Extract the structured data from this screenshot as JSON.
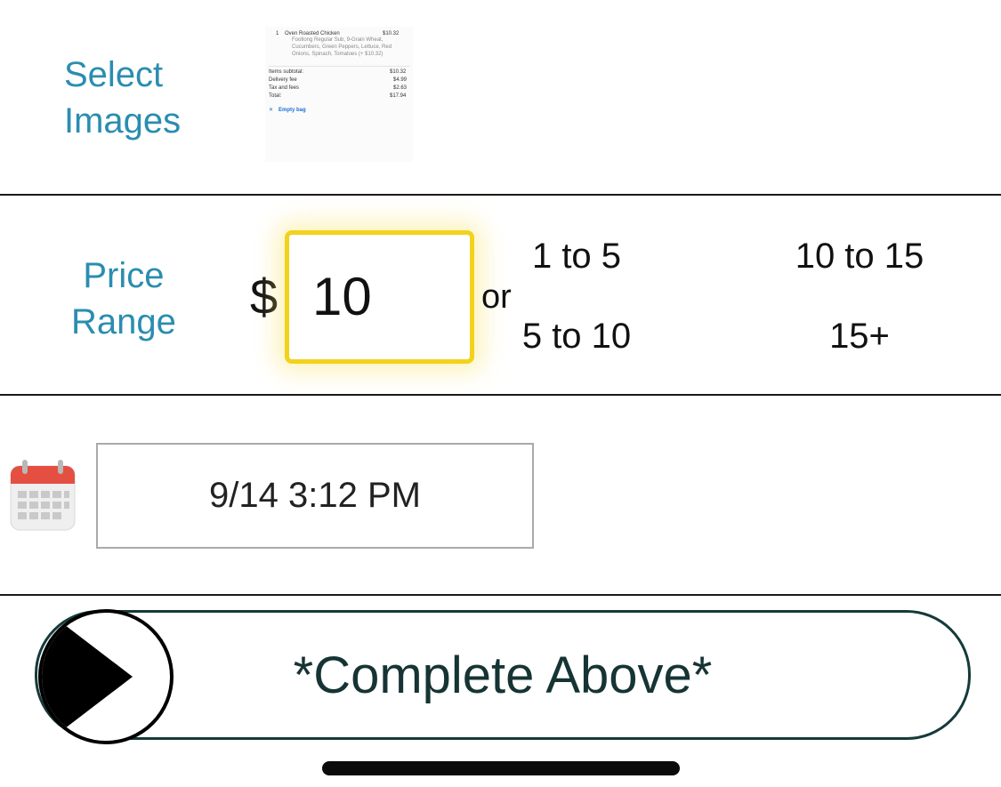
{
  "select_images": {
    "label_line1": "Select",
    "label_line2": "Images",
    "receipt": {
      "qty": "1",
      "item_name": "Oven Roasted Chicken",
      "item_price": "$10.32",
      "desc_line1": "Footlong Regular Sub, 9-Grain Wheat,",
      "desc_line2": "Cucumbers, Green Peppers, Lettuce, Red",
      "desc_line3": "Onions, Spinach, Tomatoes (+ $10.32)",
      "subtotal_label": "Items subtotal:",
      "subtotal_value": "$10.32",
      "delivery_label": "Delivery fee",
      "delivery_value": "$4.99",
      "tax_label": "Tax and fees",
      "tax_value": "$2.63",
      "total_label": "Total:",
      "total_value": "$17.94",
      "empty_bag": "Empty bag"
    }
  },
  "price": {
    "label_line1": "Price",
    "label_line2": "Range",
    "currency": "$",
    "value": "10",
    "or": "or",
    "options": {
      "opt_1_5": "1 to 5",
      "opt_10_15": "10 to 15",
      "opt_5_10": "5 to 10",
      "opt_15_plus": "15+"
    }
  },
  "datetime": {
    "value": "9/14 3:12 PM",
    "icon": "calendar-icon"
  },
  "submit": {
    "label": "*Complete Above*",
    "icon": "play-icon"
  },
  "colors": {
    "accent_teal": "#2a8db0",
    "highlight_yellow": "#f2d21a",
    "slider_border": "#153a3a"
  }
}
